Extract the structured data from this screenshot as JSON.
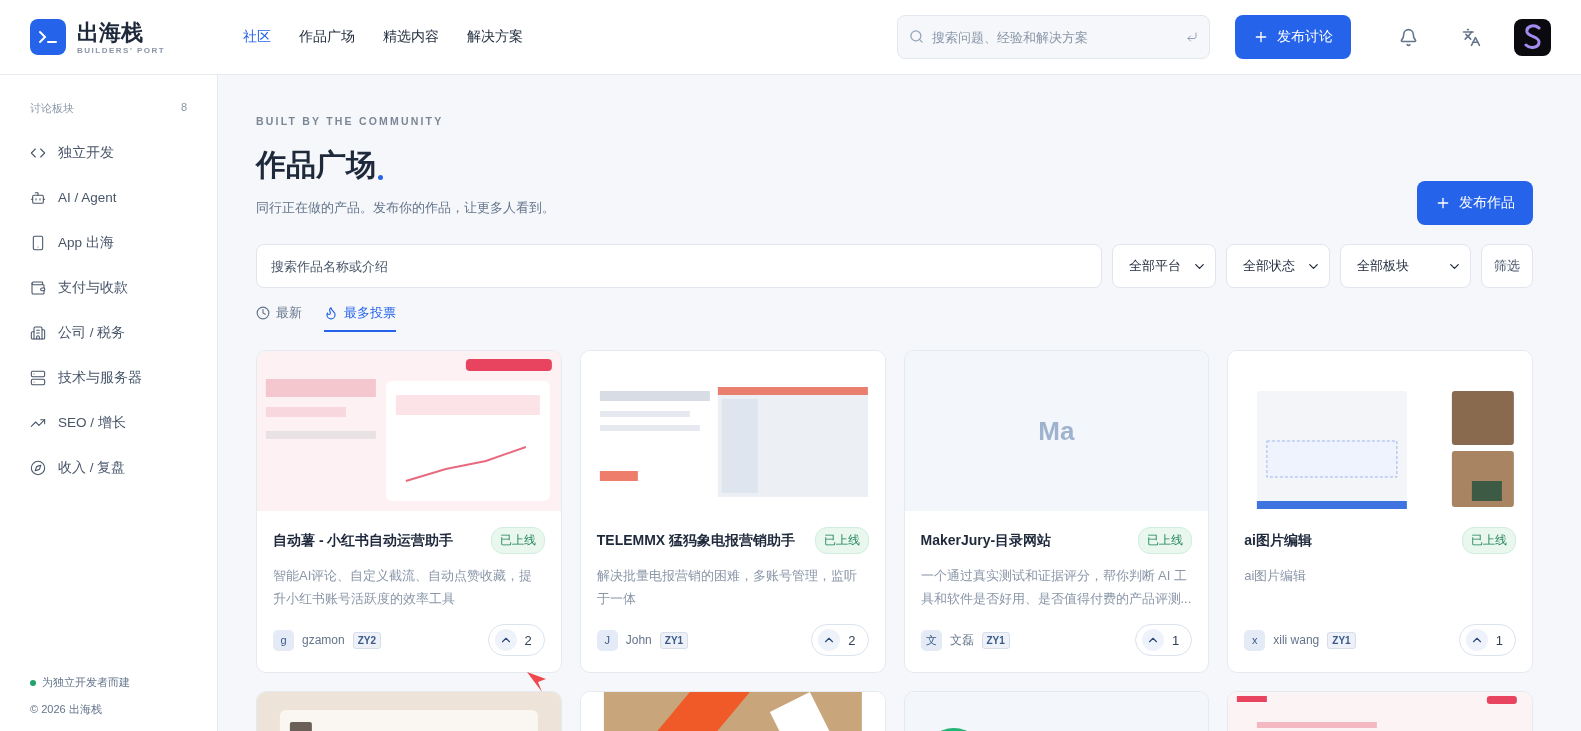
{
  "header": {
    "logo": {
      "title": "出海栈",
      "subtitle": "BUILDERS' PORT"
    },
    "nav": [
      {
        "label": "社区",
        "selected": true
      },
      {
        "label": "作品广场",
        "selected": false
      },
      {
        "label": "精选内容",
        "selected": false
      },
      {
        "label": "解决方案",
        "selected": false
      }
    ],
    "search": {
      "placeholder": "搜索问题、经验和解决方案"
    },
    "post_button": "发布讨论"
  },
  "sidebar": {
    "heading": "讨论板块",
    "count": "8",
    "items": [
      {
        "label": "独立开发"
      },
      {
        "label": "AI / Agent"
      },
      {
        "label": "App 出海"
      },
      {
        "label": "支付与收款"
      },
      {
        "label": "公司 / 税务"
      },
      {
        "label": "技术与服务器"
      },
      {
        "label": "SEO / 增长"
      },
      {
        "label": "收入 / 复盘"
      }
    ],
    "footer": {
      "status": "为独立开发者而建",
      "copyright": "© 2026 出海栈"
    }
  },
  "main": {
    "eyebrow": "BUILT BY THE COMMUNITY",
    "title": "作品广场",
    "subtitle": "同行正在做的产品。发布你的作品，让更多人看到。",
    "publish_button": "发布作品",
    "search": {
      "placeholder": "搜索作品名称或介绍"
    },
    "filters": [
      "全部平台",
      "全部状态",
      "全部板块"
    ],
    "filter_button": "筛选",
    "sort_tabs": [
      {
        "label": "最新",
        "selected": false
      },
      {
        "label": "最多投票",
        "selected": true
      }
    ],
    "products": [
      {
        "thumbnail": {
          "kind": "picture"
        },
        "title": "自动薯 - 小红书自动运营助手",
        "status": "已上线",
        "description": "智能AI评论、自定义截流、自动点赞收藏，提升小红书账号活跃度的效率工具",
        "author": {
          "initial": "g",
          "name": "gzamon"
        },
        "tag": "ZY2",
        "votes": "2"
      },
      {
        "thumbnail": {
          "kind": "picture"
        },
        "title": "TELEMMX 猛犸象电报营销助手",
        "status": "已上线",
        "description": "解决批量电报营销的困难，多账号管理，监听于一体",
        "author": {
          "initial": "J",
          "name": "John"
        },
        "tag": "ZY1",
        "votes": "2"
      },
      {
        "thumbnail": {
          "kind": "initials",
          "text": "Ma"
        },
        "title": "MakerJury-目录网站",
        "status": "已上线",
        "description": "一个通过真实测试和证据评分，帮你判断 AI 工具和软件是否好用、是否值得付费的产品评测...",
        "author": {
          "initial": "文",
          "name": "文磊"
        },
        "tag": "ZY1",
        "votes": "1"
      },
      {
        "thumbnail": {
          "kind": "picture"
        },
        "title": "ai图片编辑",
        "status": "已上线",
        "description": "ai图片编辑",
        "author": {
          "initial": "x",
          "name": "xili wang"
        },
        "tag": "ZY1",
        "votes": "1"
      }
    ],
    "more_products": [
      {
        "kind": "picture"
      },
      {
        "kind": "picture"
      },
      {
        "kind": "picture"
      },
      {
        "kind": "picture"
      }
    ]
  }
}
